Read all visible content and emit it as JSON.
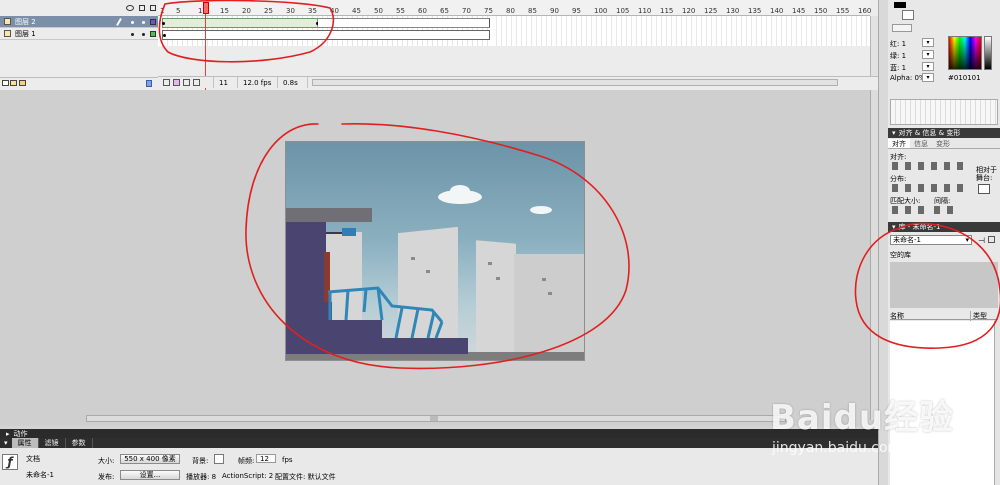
{
  "timeline": {
    "layers": [
      {
        "name": "图层 2"
      },
      {
        "name": "图层 1"
      }
    ],
    "ruler_ticks": [
      "1",
      "5",
      "10",
      "15",
      "20",
      "25",
      "30",
      "35",
      "40",
      "45",
      "50",
      "55",
      "60",
      "65",
      "70",
      "75",
      "80",
      "85",
      "90",
      "95",
      "100",
      "105",
      "110",
      "115",
      "120",
      "125",
      "130",
      "135",
      "140",
      "145",
      "150",
      "155",
      "160"
    ],
    "current_frame": "11",
    "fps": "12.0 fps",
    "time": "0.8s"
  },
  "actions_panel": {
    "label": "动作"
  },
  "props_panel": {
    "tabs": [
      "属性",
      "滤镜",
      "参数"
    ],
    "doc_type": "文档",
    "doc_name": "未命名-1",
    "size_label": "大小:",
    "size_value": "550 x 400 像素",
    "bg_label": "背景:",
    "fps_label": "帧频:",
    "fps_value": "12",
    "fps_unit": "fps",
    "publish_label": "发布:",
    "settings_button": "设置...",
    "player_label": "播放器: 8",
    "as_label": "ActionScript: 2",
    "profile_label": "配置文件: 默认文件"
  },
  "color_mixer": {
    "red_label": "红: 1",
    "green_label": "绿: 1",
    "blue_label": "蓝: 1",
    "alpha_label": "Alpha: 0%",
    "hex_value": "#010101"
  },
  "align_panel": {
    "title": "对齐 & 信息 & 变形",
    "tabs": [
      "对齐",
      "信息",
      "变形"
    ],
    "align_label": "对齐:",
    "distribute_label": "分布:",
    "match_size_label": "匹配大小:",
    "spacing_label": "间隔:",
    "to_stage_label": "相对于舞台:"
  },
  "library_panel": {
    "title": "库 - 未命名-1",
    "doc_select": "未命名-1",
    "empty_label": "空的库",
    "col_name": "名称",
    "col_type": "类型"
  },
  "watermark": {
    "brand": "Baidu经验",
    "url": "jingyan.baidu.com"
  },
  "colors": {
    "annotation": "#e02020",
    "panel_dark": "#2e2e2e",
    "stage_sky": "#7fa6b8"
  }
}
